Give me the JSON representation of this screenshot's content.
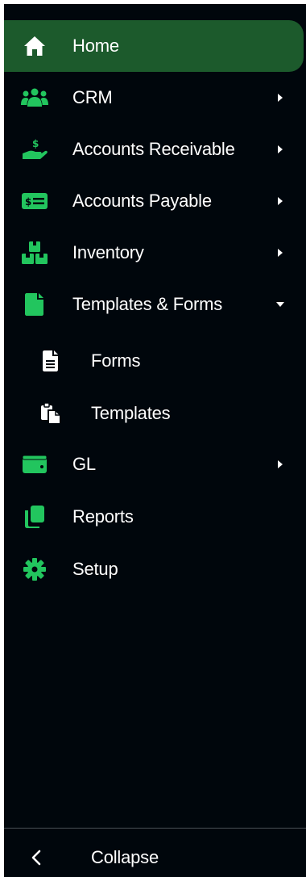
{
  "colors": {
    "sidebar_bg": "#00060c",
    "active_bg": "#1c5a2c",
    "icon_green": "#22c55e",
    "text": "#ffffff"
  },
  "nav": {
    "items": [
      {
        "label": "Home",
        "icon": "home-icon",
        "active": true
      },
      {
        "label": "CRM",
        "icon": "users-icon",
        "caret": "right"
      },
      {
        "label": "Accounts Receivable",
        "icon": "hand-dollar-icon",
        "caret": "right"
      },
      {
        "label": "Accounts Payable",
        "icon": "money-bill-icon",
        "caret": "right"
      },
      {
        "label": "Inventory",
        "icon": "boxes-icon",
        "caret": "right"
      },
      {
        "label": "Templates & Forms",
        "icon": "file-icon",
        "caret": "down",
        "expanded": true
      },
      {
        "label": "GL",
        "icon": "wallet-icon",
        "caret": "right"
      },
      {
        "label": "Reports",
        "icon": "copy-icon"
      },
      {
        "label": "Setup",
        "icon": "gear-icon"
      }
    ],
    "subitems": [
      {
        "label": "Forms",
        "icon": "file-lines-icon"
      },
      {
        "label": "Templates",
        "icon": "paste-icon"
      }
    ]
  },
  "footer": {
    "collapse_label": "Collapse",
    "collapse_icon": "chevron-left-icon"
  }
}
